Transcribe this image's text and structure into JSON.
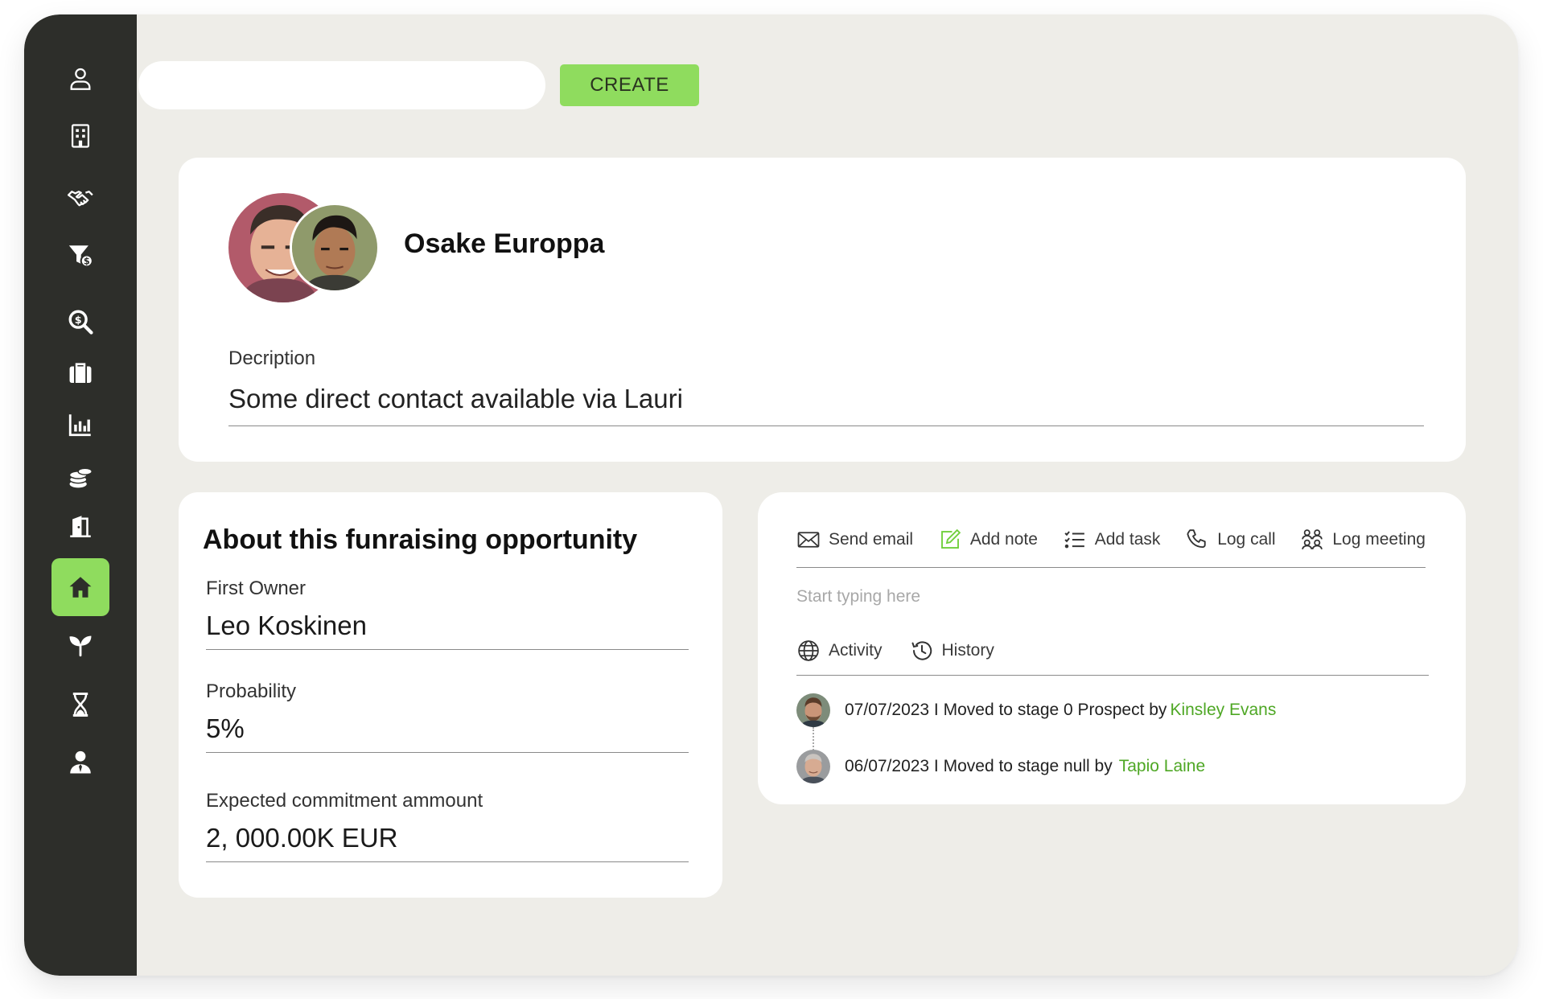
{
  "toolbar": {
    "search_value": "",
    "create_label": "CREATE"
  },
  "sidebar": {
    "items": [
      {
        "icon": "user-icon"
      },
      {
        "icon": "building-icon"
      },
      {
        "icon": "handshake-icon"
      },
      {
        "icon": "funnel-dollar-icon"
      },
      {
        "icon": "search-dollar-icon"
      },
      {
        "icon": "briefcase-icon"
      },
      {
        "icon": "bar-chart-icon"
      },
      {
        "icon": "coins-icon"
      },
      {
        "icon": "door-icon"
      },
      {
        "icon": "home-icon",
        "active": true
      },
      {
        "icon": "seedling-icon"
      },
      {
        "icon": "hourglass-icon"
      },
      {
        "icon": "person-tie-icon"
      }
    ]
  },
  "profile": {
    "name": "Osake Europpa",
    "description_label": "Decription",
    "description_value": "Some direct contact available via Lauri"
  },
  "about": {
    "title": "About this funraising opportunity",
    "fields": [
      {
        "label": "First Owner",
        "value": "Leo Koskinen"
      },
      {
        "label": "Probability",
        "value": "5%"
      },
      {
        "label": "Expected commitment ammount",
        "value": "2, 000.00K  EUR"
      }
    ]
  },
  "activity": {
    "actions": [
      {
        "label": "Send email",
        "icon": "envelope-icon"
      },
      {
        "label": "Add note",
        "icon": "note-edit-icon"
      },
      {
        "label": "Add task",
        "icon": "checklist-icon"
      },
      {
        "label": "Log call",
        "icon": "phone-icon"
      },
      {
        "label": "Log meeting",
        "icon": "people-group-icon"
      }
    ],
    "input_placeholder": "Start typing here",
    "tabs": [
      {
        "label": "Activity",
        "icon": "globe-icon"
      },
      {
        "label": "History",
        "icon": "history-icon"
      }
    ],
    "entries": [
      {
        "text": "07/07/2023 I Moved to stage 0 Prospect by",
        "user": "Kinsley Evans"
      },
      {
        "text": "06/07/2023 I Moved to stage null  by",
        "user": "Tapio Laine"
      }
    ]
  },
  "colors": {
    "accent": "#8fdc5e",
    "sidebar": "#2d2e2a",
    "background": "#eeede8",
    "link": "#4ea724"
  }
}
